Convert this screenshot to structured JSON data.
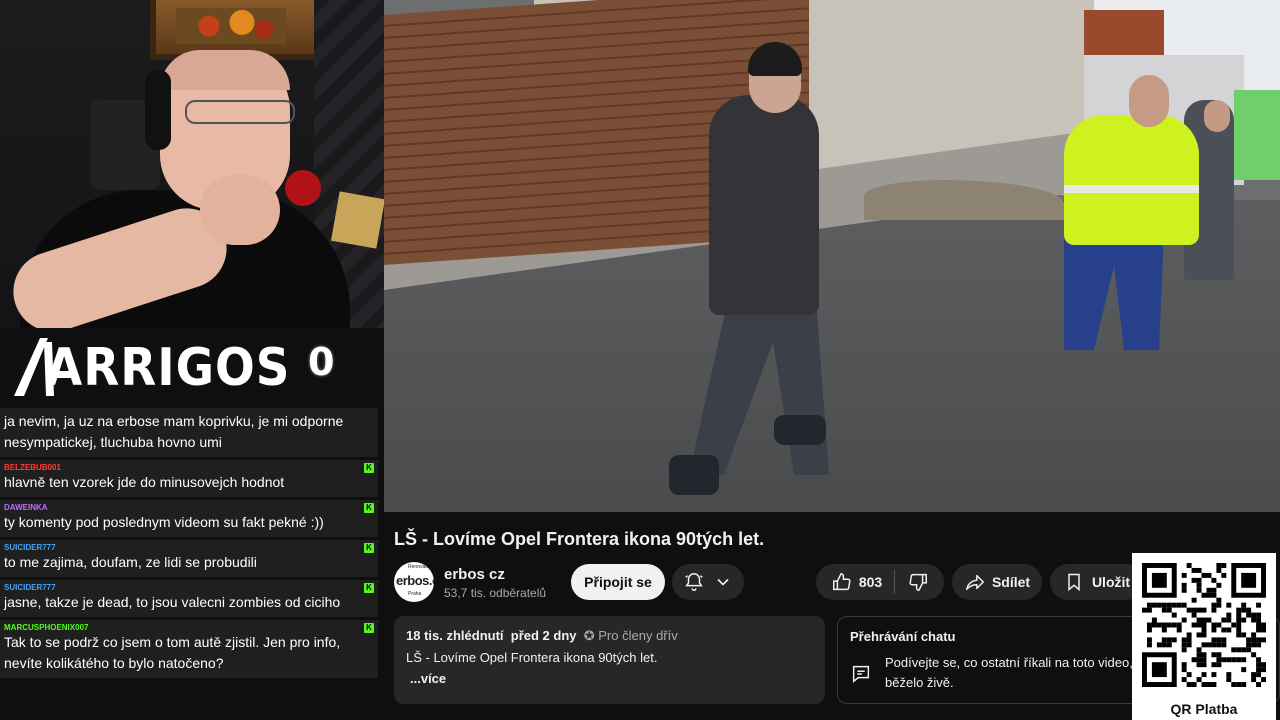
{
  "overlay": {
    "logo_text": "ARRIGOS",
    "counter": "0",
    "qr_label": "QR Platba"
  },
  "chat": [
    {
      "user": "",
      "color": "#ffffff",
      "text": "ja nevim, ja uz na erbose mam koprivku, je mi odporne nesympatickej, tluchuba hovno umi",
      "badge": false
    },
    {
      "user": "BELZEBUB001",
      "color": "#ff3a3a",
      "text": "hlavně ten vzorek jde do minusovejch hodnot",
      "badge": true
    },
    {
      "user": "DAWEINKA",
      "color": "#c06bff",
      "text": "ty komenty pod poslednym videom su fakt pekné :))",
      "badge": true
    },
    {
      "user": "SUICIDER777",
      "color": "#3fa2ff",
      "text": "to me zajima, doufam, ze lidi se probudili",
      "badge": true
    },
    {
      "user": "SUICIDER777",
      "color": "#3fa2ff",
      "text": "jasne, takze je dead, to jsou valecni zombies od ciciho",
      "badge": true
    },
    {
      "user": "MARCUSPHOENIX007",
      "color": "#53fc18",
      "text": "Tak to se podrž co jsem o tom autě zjistil. Jen pro info, nevíte kolikátého to bylo natočeno?",
      "badge": true
    }
  ],
  "video": {
    "title": "LŠ - Lovíme Opel Frontera ikona 90tých let.",
    "channel": {
      "name": "erbos cz",
      "subscribers": "53,7 tis. odběratelů",
      "avatar_top": "Renovace",
      "avatar_text": "erbos.c",
      "avatar_bottom": "Praha"
    },
    "actions": {
      "join": "Připojit se",
      "likes": "803",
      "share": "Sdílet",
      "save": "Uložit"
    },
    "description": {
      "views": "18 tis. zhlédnutí",
      "date": "před 2 dny",
      "members": "Pro členy dřív",
      "line": "LŠ - Lovíme Opel Frontera ikona 90tých let.",
      "more": "...více"
    },
    "chat_replay": {
      "title": "Přehrávání chatu",
      "body": "Podívejte se, co ostatní říkali na toto video, když běželo živě."
    }
  }
}
